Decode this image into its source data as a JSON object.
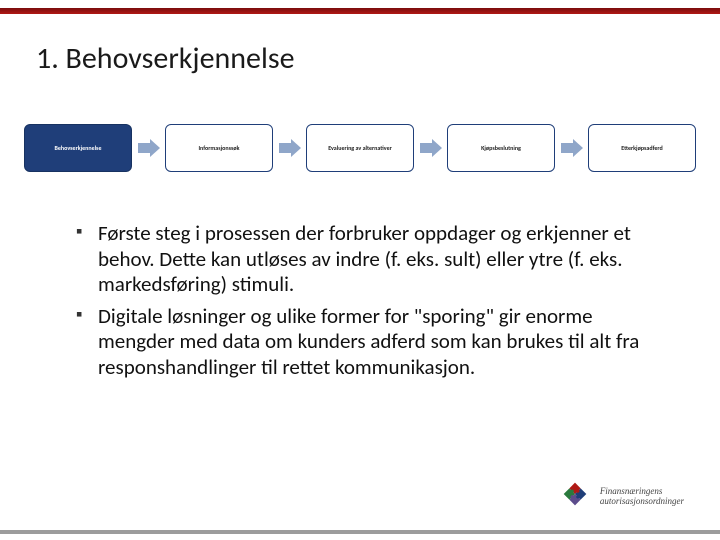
{
  "title": "1. Behovserkjennelse",
  "process": {
    "stages": [
      {
        "label": "Behovserkjennelse",
        "active": true
      },
      {
        "label": "Informasjonssøk",
        "active": false
      },
      {
        "label": "Evaluering av alternativer",
        "active": false
      },
      {
        "label": "Kjøpsbeslutning",
        "active": false
      },
      {
        "label": "Etterkjøpsadferd",
        "active": false
      }
    ]
  },
  "bullets": [
    "Første steg i prosessen der forbruker oppdager og erkjenner et behov. Dette kan utløses av indre (f. eks. sult) eller ytre (f. eks. markedsføring) stimuli.",
    "Digitale løsninger og ulike former for \"sporing\" gir enorme mengder med data om kunders adferd som kan brukes til alt fra responshandlinger til rettet kommunikasjon."
  ],
  "footer": {
    "org_line1": "Finansnæringens",
    "org_line2": "autorisasjonsordninger"
  },
  "colors": {
    "accent_red": "#b01914",
    "stage_active": "#1f3e79",
    "stage_border": "#1f3e79",
    "arrow": "#8fa6c9"
  }
}
